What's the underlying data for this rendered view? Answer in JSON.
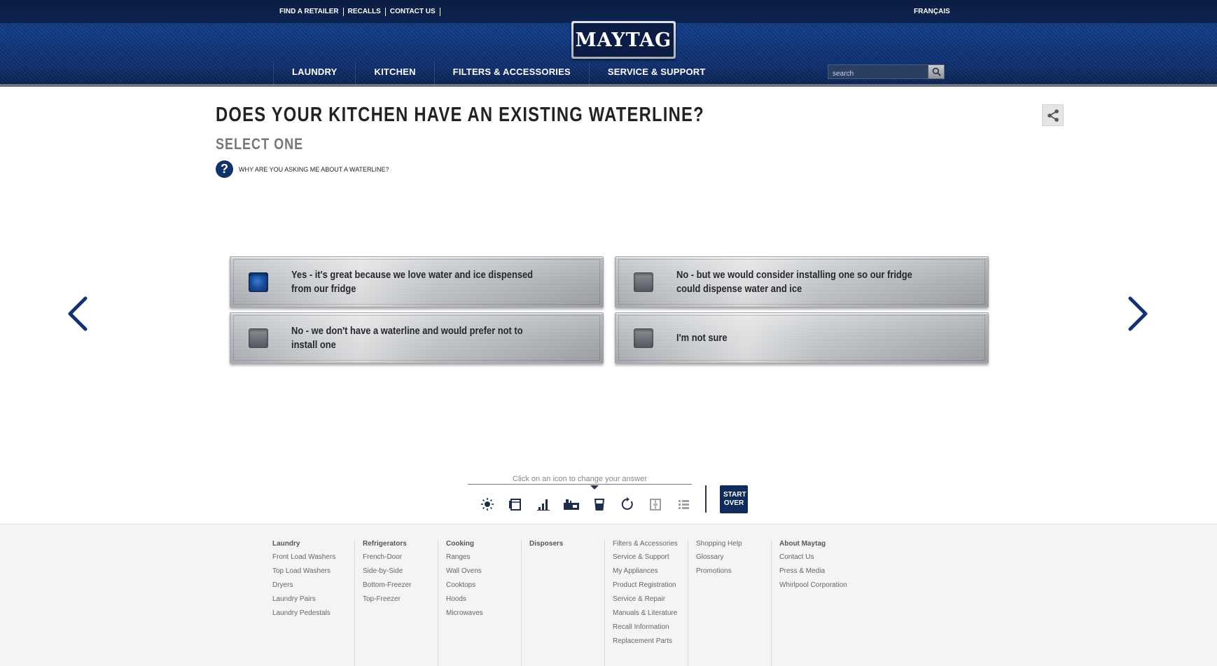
{
  "header": {
    "toplinks": [
      "FIND A RETAILER",
      "RECALLS",
      "CONTACT US"
    ],
    "language": "FRANÇAIS",
    "logo": "MAYTAG",
    "nav": [
      "LAUNDRY",
      "KITCHEN",
      "FILTERS & ACCESSORIES",
      "SERVICE & SUPPORT"
    ],
    "search_placeholder": "search"
  },
  "question": {
    "title": "DOES YOUR KITCHEN HAVE AN EXISTING WATERLINE?",
    "subtitle": "SELECT ONE",
    "help_icon": "?",
    "help_text": "WHY ARE YOU ASKING ME ABOUT A WATERLINE?"
  },
  "options": [
    {
      "label": "Yes - it's great because we love water and ice dispensed from our fridge",
      "checked": true
    },
    {
      "label": "No - but we would consider installing one so our fridge could dispense water and ice",
      "checked": false
    },
    {
      "label": "No - we don't have a waterline and would prefer not to install one",
      "checked": false
    },
    {
      "label": "I'm not sure",
      "checked": false
    }
  ],
  "progress": {
    "hint": "Click on an icon to change your answer",
    "icons": [
      "sun-icon",
      "fridge-icon",
      "bar-chart-icon",
      "kitchen-icon",
      "water-glass-icon",
      "refresh-icon",
      "door-icon",
      "list-icon"
    ],
    "start_over": "START OVER"
  },
  "colors": {
    "brand_navy": "#0f2c5c",
    "header_blue": "#123a86",
    "selected_blue": "#1b4f9f"
  },
  "footer": {
    "columns": [
      {
        "heading": "Laundry",
        "items": [
          "Front Load Washers",
          "Top Load Washers",
          "Dryers",
          "Laundry Pairs",
          "Laundry Pedestals"
        ]
      },
      {
        "heading": "Refrigerators",
        "items": [
          "French-Door",
          "Side-by-Side",
          "Bottom-Freezer",
          "Top-Freezer"
        ]
      },
      {
        "heading": "Cooking",
        "items": [
          "Ranges",
          "Wall Ovens",
          "Cooktops",
          "Hoods",
          "Microwaves"
        ]
      },
      {
        "heading": "Disposers",
        "items": []
      },
      {
        "heading": "Filters & Accessories",
        "items": [
          "Service & Support",
          "My Appliances",
          "Product Registration",
          "Service & Repair",
          "Manuals & Literature",
          "Recall Information",
          "Replacement Parts"
        ]
      },
      {
        "heading": "Shopping Help",
        "items": [
          "Glossary",
          "Promotions"
        ]
      },
      {
        "heading": "About Maytag",
        "items": [
          "Contact Us",
          "Press & Media",
          "Whirlpool Corporation"
        ]
      }
    ]
  }
}
